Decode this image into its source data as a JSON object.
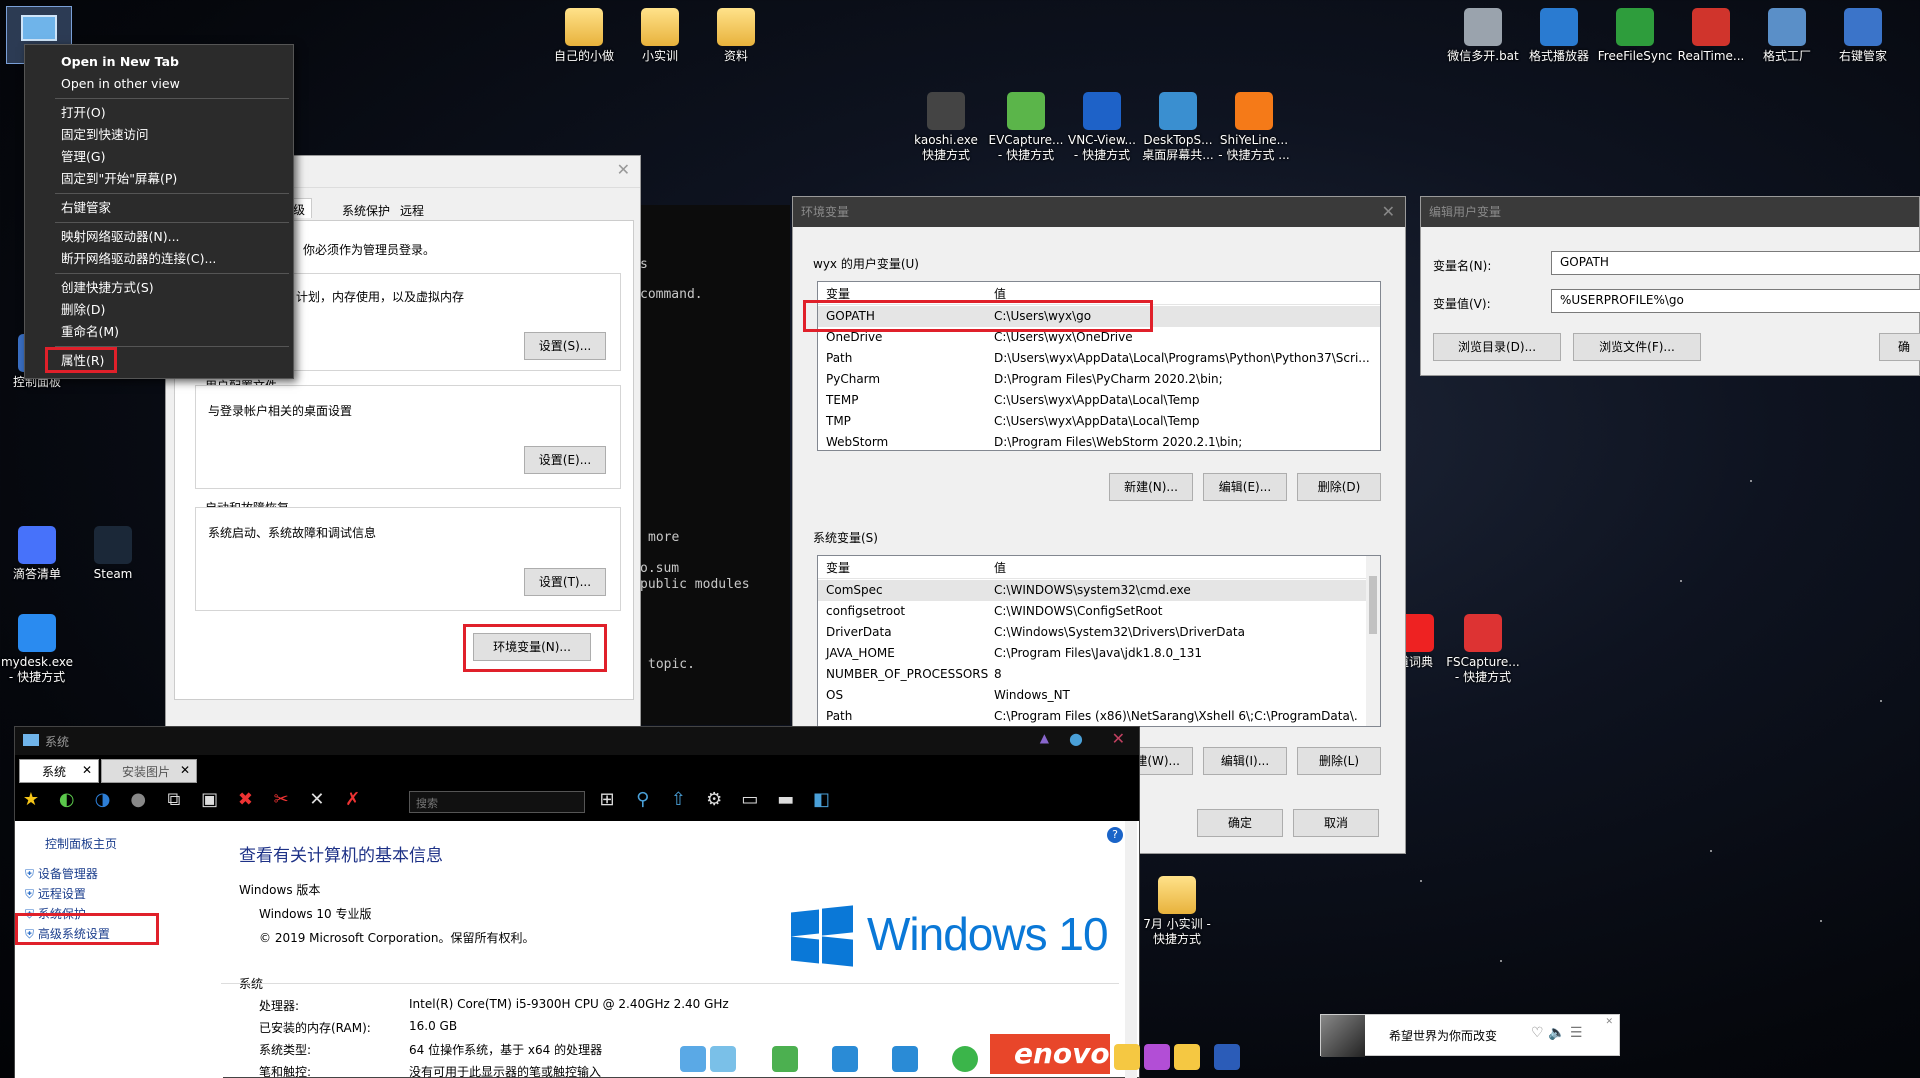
{
  "desktop": {
    "icons": [
      {
        "name": "folder-icon",
        "label": "自己的小做",
        "kind": "folder"
      },
      {
        "name": "folder-icon",
        "label": "小实训",
        "kind": "folder"
      },
      {
        "name": "folder-icon",
        "label": "资料",
        "kind": "folder"
      },
      {
        "name": "bat-icon",
        "label": "微信多开.bat",
        "kind": "app",
        "color": "#9aa3ad"
      },
      {
        "name": "player-icon",
        "label": "格式播放器",
        "kind": "app",
        "color": "#2a7bd1"
      },
      {
        "name": "sync-icon",
        "label": "FreeFileSync",
        "kind": "app",
        "color": "#2e9d3c"
      },
      {
        "name": "sync-red-icon",
        "label": "RealTime...",
        "kind": "app",
        "color": "#d0342c"
      },
      {
        "name": "format-factory-icon",
        "label": "格式工厂",
        "kind": "app",
        "color": "#5a8fc8"
      },
      {
        "name": "right-click-icon",
        "label": "右键管家",
        "kind": "app",
        "color": "#3b74c9"
      },
      {
        "name": "kaoshi-icon",
        "label": "kaoshi.exe\n快捷方式",
        "kind": "app",
        "color": "#444"
      },
      {
        "name": "evcapture-icon",
        "label": "EVCapture...\n- 快捷方式",
        "kind": "app",
        "color": "#5bb54a"
      },
      {
        "name": "vnc-icon",
        "label": "VNC-View...\n- 快捷方式",
        "kind": "app",
        "color": "#1e62c8"
      },
      {
        "name": "desktops-icon",
        "label": "DeskTopS...\n桌面屏幕共...",
        "kind": "app",
        "color": "#3a8fd0"
      },
      {
        "name": "shiyeline-icon",
        "label": "ShiYeLine...\n- 快捷方式 ...",
        "kind": "app",
        "color": "#f57a18"
      },
      {
        "name": "control-panel-icon",
        "label": "控制面板",
        "kind": "app",
        "color": "#3a6fc4"
      },
      {
        "name": "ticktick-icon",
        "label": "滴答清单",
        "kind": "app",
        "color": "#4772fa"
      },
      {
        "name": "steam-icon",
        "label": "Steam",
        "kind": "app",
        "color": "#1b2838"
      },
      {
        "name": "mydesk-icon",
        "label": "mydesk.exe\n- 快捷方式",
        "kind": "app",
        "color": "#2a8bf0"
      },
      {
        "name": "dict-icon",
        "label": "道词典",
        "kind": "app",
        "color": "#e22"
      },
      {
        "name": "fscapture-icon",
        "label": "FSCapture...\n- 快捷方式",
        "kind": "app",
        "color": "#d33"
      },
      {
        "name": "folder-icon",
        "label": "7月 小实训 -\n快捷方式",
        "kind": "folder"
      }
    ]
  },
  "context_menu": {
    "items": [
      "Open in New Tab",
      "Open in other view",
      "打开(O)",
      "固定到快速访问",
      "管理(G)",
      "固定到\"开始\"屏幕(P)",
      "右键管家",
      "映射网络驱动器(N)...",
      "断开网络驱动器的连接(C)...",
      "创建快捷方式(S)",
      "删除(D)",
      "重命名(M)",
      "属性(R)"
    ]
  },
  "sysprops": {
    "tabs": [
      "级",
      "系统保护",
      "远程"
    ],
    "admin_note": "你必须作为管理员登录。",
    "perf_text": "计划，内存使用，以及虚拟内存",
    "settings_btn": "设置(S)...",
    "profile_title": "用户配置文件",
    "profile_text": "与登录帐户相关的桌面设置",
    "profile_btn": "设置(E)...",
    "startup_title": "启动和故障恢复",
    "startup_text": "系统启动、系统故障和调试信息",
    "startup_btn": "设置(T)...",
    "env_btn": "环境变量(N)..."
  },
  "terminal": {
    "lines": [
      "s",
      "command.",
      "more",
      "o.sum",
      "public modules",
      "topic."
    ]
  },
  "envvars": {
    "title": "环境变量",
    "user_label": "wyx 的用户变量(U)",
    "col_var": "变量",
    "col_val": "值",
    "user_vars": [
      [
        "GOPATH",
        "C:\\Users\\wyx\\go"
      ],
      [
        "OneDrive",
        "C:\\Users\\wyx\\OneDrive"
      ],
      [
        "Path",
        "D:\\Users\\wyx\\AppData\\Local\\Programs\\Python\\Python37\\Scri..."
      ],
      [
        "PyCharm",
        "D:\\Program Files\\PyCharm 2020.2\\bin;"
      ],
      [
        "TEMP",
        "C:\\Users\\wyx\\AppData\\Local\\Temp"
      ],
      [
        "TMP",
        "C:\\Users\\wyx\\AppData\\Local\\Temp"
      ],
      [
        "WebStorm",
        "D:\\Program Files\\WebStorm 2020.2.1\\bin;"
      ]
    ],
    "new_btn": "新建(N)...",
    "edit_btn": "编辑(E)...",
    "delete_btn": "删除(D)",
    "sys_label": "系统变量(S)",
    "sys_vars": [
      [
        "ComSpec",
        "C:\\WINDOWS\\system32\\cmd.exe"
      ],
      [
        "configsetroot",
        "C:\\WINDOWS\\ConfigSetRoot"
      ],
      [
        "DriverData",
        "C:\\Windows\\System32\\Drivers\\DriverData"
      ],
      [
        "JAVA_HOME",
        "C:\\Program Files\\Java\\jdk1.8.0_131"
      ],
      [
        "NUMBER_OF_PROCESSORS",
        "8"
      ],
      [
        "OS",
        "Windows_NT"
      ],
      [
        "Path",
        "C:\\Program Files (x86)\\NetSarang\\Xshell 6\\;C:\\ProgramData\\..."
      ]
    ],
    "sys_new_btn": "建(W)...",
    "sys_edit_btn": "编辑(I)...",
    "sys_delete_btn": "删除(L)",
    "ok_btn": "确定",
    "cancel_btn": "取消"
  },
  "edituser": {
    "title": "编辑用户变量",
    "name_label": "变量名(N):",
    "name_value": "GOPATH",
    "value_label": "变量值(V):",
    "value_value": "%USERPROFILE%\\go",
    "browse_dir": "浏览目录(D)...",
    "browse_file": "浏览文件(F)...",
    "cut_btn": "确"
  },
  "explorer": {
    "title": "系统",
    "tabs": [
      "系统",
      "安装图片"
    ],
    "search_placeholder": "搜索",
    "nav": [
      "控制面板主页",
      "设备管理器",
      "远程设置",
      "系统保护",
      "高级系统设置"
    ],
    "heading": "查看有关计算机的基本信息",
    "win_edition_label": "Windows 版本",
    "edition": "Windows 10 专业版",
    "copyright": "© 2019 Microsoft Corporation。保留所有权利。",
    "logo_text": "Windows 10",
    "system_label": "系统",
    "specs": [
      [
        "处理器:",
        "Intel(R) Core(TM) i5-9300H CPU @ 2.40GHz   2.40 GHz"
      ],
      [
        "已安装的内存(RAM):",
        "16.0 GB"
      ],
      [
        "系统类型:",
        "64 位操作系统，基于 x64 的处理器"
      ],
      [
        "笔和触控:",
        "没有可用于此显示器的笔或触控输入"
      ]
    ]
  },
  "music": {
    "text": "希望世界为你而改变"
  },
  "taskbar": {
    "brand": "enovo"
  },
  "colors": {
    "highlight": "#e0202a",
    "windows_blue": "#0a78d7",
    "dark_title": "#2b2b2b"
  }
}
